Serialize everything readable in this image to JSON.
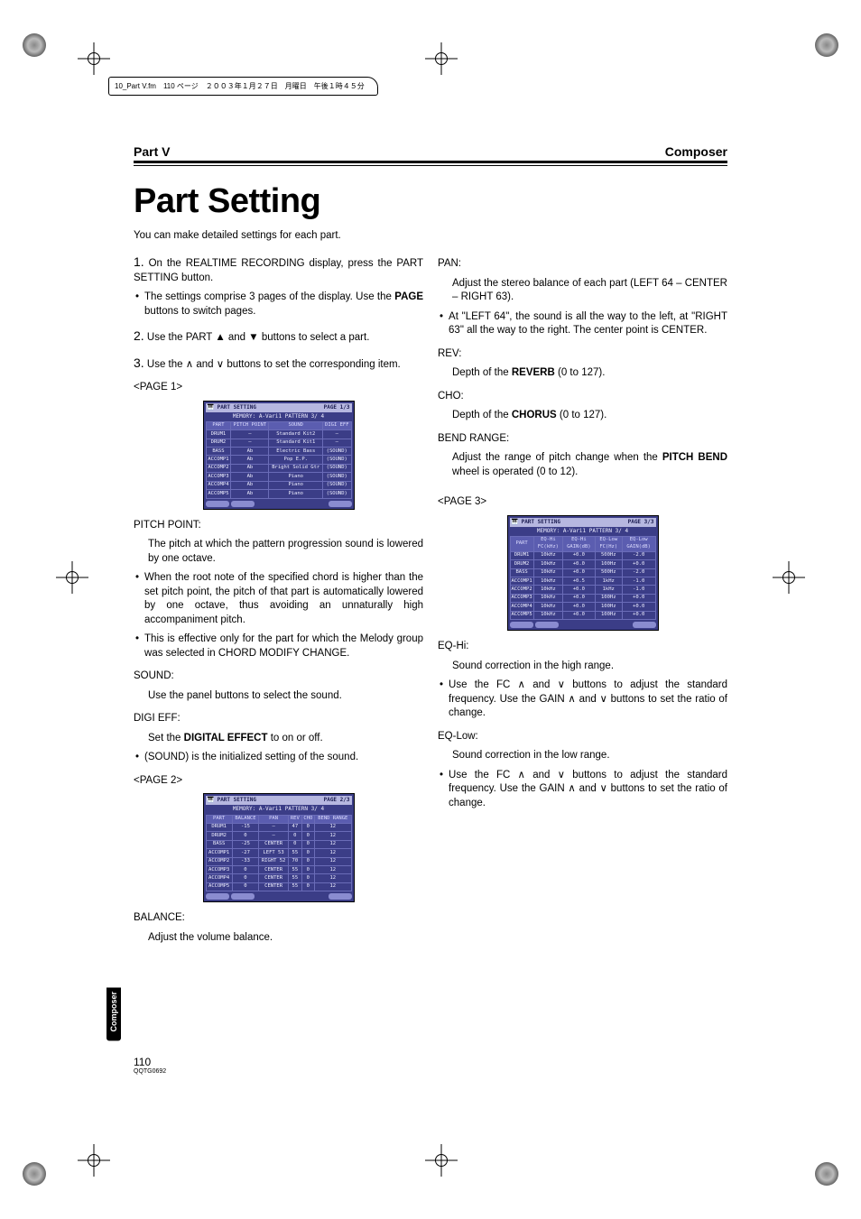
{
  "file_header": "10_Part V.fm　110 ページ　２００３年１月２７日　月曜日　午後１時４５分",
  "running_left": "Part V",
  "running_right": "Composer",
  "chapter_title": "Part Setting",
  "intro": "You can make detailed settings for each part.",
  "step1": "On the REALTIME RECORDING display, press the PART SETTING button.",
  "step1_bullet": "The settings comprise 3 pages of the display. Use the PAGE buttons to switch pages.",
  "step2": "Use the PART ▲ and ▼ buttons to select a part.",
  "step3": "Use the ∧ and ∨ buttons to set the corresponding item.",
  "page1_label": "<PAGE 1>",
  "pitch_point_label": "PITCH POINT:",
  "pitch_point_text": "The pitch at which the pattern progression sound is lowered by one octave.",
  "pitch_point_b1": "When the root note of the specified chord is higher than the set pitch point, the pitch of that part is automatically lowered by one octave, thus avoiding an unnaturally high accompaniment pitch.",
  "pitch_point_b2": "This is effective only for the part for which the Melody group was selected in CHORD MODIFY CHANGE.",
  "sound_label": "SOUND:",
  "sound_text": "Use the panel buttons to select the sound.",
  "digi_label": "DIGI EFF:",
  "digi_text_pre": "Set the ",
  "digi_text_bold": "DIGITAL EFFECT",
  "digi_text_post": " to on or off.",
  "digi_bullet": "(SOUND) is the initialized setting of the sound.",
  "page2_label": "<PAGE 2>",
  "balance_label": "BALANCE:",
  "balance_text": "Adjust the volume balance.",
  "pan_label": "PAN:",
  "pan_text": "Adjust the stereo balance of each part (LEFT 64 – CENTER – RIGHT 63).",
  "pan_bullet": "At \"LEFT 64\", the sound is all the way to the left, at \"RIGHT 63\" all the way to the right. The center point is CENTER.",
  "rev_label": "REV:",
  "rev_text_pre": "Depth of the ",
  "rev_text_bold": "REVERB",
  "rev_text_post": " (0 to 127).",
  "cho_label": "CHO:",
  "cho_text_pre": "Depth of the ",
  "cho_text_bold": "CHORUS",
  "cho_text_post": " (0 to 127).",
  "bend_label": "BEND RANGE:",
  "bend_text_pre": "Adjust the range of pitch change when the ",
  "bend_text_bold": "PITCH BEND",
  "bend_text_post": " wheel is operated (0 to 12).",
  "page3_label": "<PAGE 3>",
  "eqhi_label": "EQ-Hi:",
  "eqhi_text": "Sound correction in the high range.",
  "eqhi_bullet": "Use the FC ∧ and ∨ buttons to adjust the standard frequency. Use the GAIN ∧ and ∨ buttons to set the ratio of change.",
  "eqlow_label": "EQ-Low:",
  "eqlow_text": "Sound correction in the low range.",
  "eqlow_bullet": "Use the FC ∧ and ∨ buttons to adjust the standard frequency. Use the GAIN ∧ and ∨ buttons to set the ratio of change.",
  "sidetab": "Composer",
  "pagenum": "110",
  "docnum": "QQTG0692",
  "lcd1": {
    "title": "PART SETTING",
    "page": "PAGE 1/3",
    "memory": "MEMORY: A-Vari1 PATTERN   3/ 4",
    "headers": [
      "PART",
      "PITCH POINT",
      "SOUND",
      "DIGI EFF"
    ],
    "rows": [
      [
        "DRUM1",
        "—",
        "Standard Kit2",
        "—"
      ],
      [
        "DRUM2",
        "—",
        "Standard Kit1",
        "—"
      ],
      [
        "BASS",
        "Ab",
        "Electric Bass",
        "(SOUND)"
      ],
      [
        "ACCOMP1",
        "Ab",
        "Pop E.P.",
        "(SOUND)"
      ],
      [
        "ACCOMP2",
        "Ab",
        "Bright Solid Gtr",
        "(SOUND)"
      ],
      [
        "ACCOMP3",
        "Ab",
        "Piano",
        "(SOUND)"
      ],
      [
        "ACCOMP4",
        "Ab",
        "Piano",
        "(SOUND)"
      ],
      [
        "ACCOMP5",
        "Ab",
        "Piano",
        "(SOUND)"
      ]
    ]
  },
  "lcd2": {
    "title": "PART SETTING",
    "page": "PAGE 2/3",
    "memory": "MEMORY: A-Vari1 PATTERN   3/ 4",
    "headers": [
      "PART",
      "BALANCE",
      "PAN",
      "REV",
      "CHO",
      "BEND RANGE"
    ],
    "rows": [
      [
        "DRUM1",
        "-15",
        "—",
        "47",
        "0",
        "12"
      ],
      [
        "DRUM2",
        "0",
        "—",
        "0",
        "0",
        "12"
      ],
      [
        "BASS",
        "-25",
        "CENTER",
        "0",
        "0",
        "12"
      ],
      [
        "ACCOMP1",
        "-27",
        "LEFT 53",
        "55",
        "0",
        "12"
      ],
      [
        "ACCOMP2",
        "-33",
        "RIGHT 52",
        "70",
        "0",
        "12"
      ],
      [
        "ACCOMP3",
        "0",
        "CENTER",
        "55",
        "0",
        "12"
      ],
      [
        "ACCOMP4",
        "0",
        "CENTER",
        "55",
        "0",
        "12"
      ],
      [
        "ACCOMP5",
        "0",
        "CENTER",
        "55",
        "0",
        "12"
      ]
    ]
  },
  "lcd3": {
    "title": "PART SETTING",
    "page": "PAGE 3/3",
    "memory": "MEMORY: A-Vari1 PATTERN   3/ 4",
    "headers": [
      "PART",
      "EQ-Hi FC(kHz)",
      "EQ-Hi GAIN(dB)",
      "EQ-Low FC(Hz)",
      "EQ-Low GAIN(dB)"
    ],
    "rows": [
      [
        "DRUM1",
        "10kHz",
        "+0.0",
        "500Hz",
        "-2.0"
      ],
      [
        "DRUM2",
        "10kHz",
        "+0.0",
        "100Hz",
        "+0.0"
      ],
      [
        "BASS",
        "10kHz",
        "+0.0",
        "500Hz",
        "-2.0"
      ],
      [
        "ACCOMP1",
        "10kHz",
        "+0.5",
        "1kHz",
        "-1.0"
      ],
      [
        "ACCOMP2",
        "10kHz",
        "+0.0",
        "1kHz",
        "-1.0"
      ],
      [
        "ACCOMP3",
        "10kHz",
        "+0.0",
        "100Hz",
        "+0.0"
      ],
      [
        "ACCOMP4",
        "10kHz",
        "+0.0",
        "100Hz",
        "+0.0"
      ],
      [
        "ACCOMP5",
        "10kHz",
        "+0.0",
        "100Hz",
        "+0.0"
      ]
    ]
  }
}
